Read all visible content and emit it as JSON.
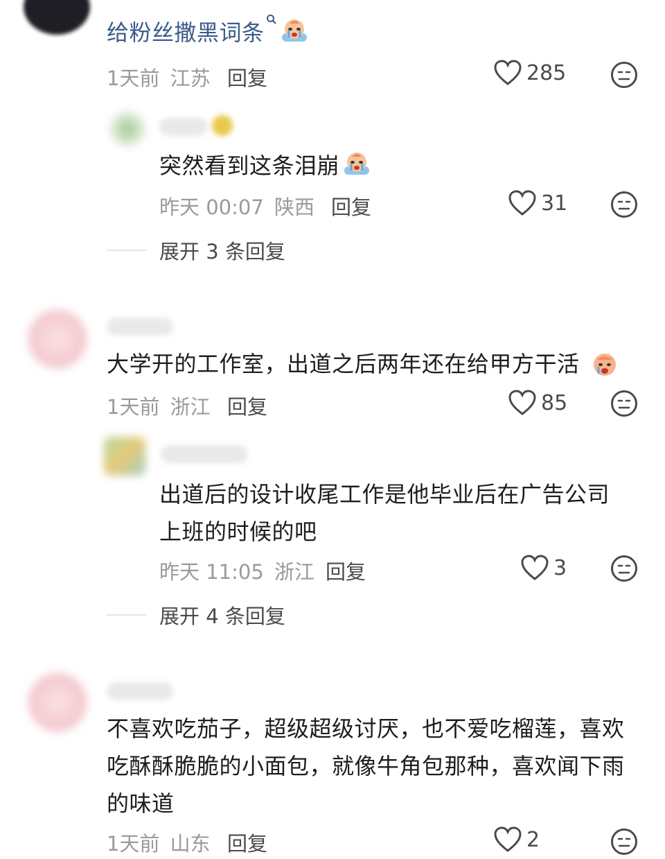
{
  "comments": [
    {
      "text": "给粉丝撒黑词条",
      "date": "1天前",
      "location": "江苏",
      "reply_label": "回复",
      "likes": "285",
      "replies": [
        {
          "text": "突然看到这条泪崩",
          "date": "昨天 00:07",
          "location": "陕西",
          "reply_label": "回复",
          "likes": "31"
        }
      ],
      "expand_label": "展开 3 条回复"
    },
    {
      "text": "大学开的工作室，出道之后两年还在给甲方干活",
      "date": "1天前",
      "location": "浙江",
      "reply_label": "回复",
      "likes": "85",
      "replies": [
        {
          "text_line1": "出道后的设计收尾工作是他毕业后在广告公司",
          "text_line2": "上班的时候的吧",
          "date": "昨天 11:05",
          "location": "浙江",
          "reply_label": "回复",
          "likes": "3"
        }
      ],
      "expand_label": "展开 4 条回复"
    },
    {
      "text_line1": "不喜欢吃茄子，超级超级讨厌，也不爱吃榴莲，喜欢",
      "text_line2": "吃酥酥脆脆的小面包，就像牛角包那种，喜欢闻下雨",
      "text_line3": "的味道",
      "date": "1天前",
      "location": "山东",
      "reply_label": "回复",
      "likes": "2"
    }
  ],
  "icons": {
    "like": "heart-outline-icon",
    "dislike": "neutral-face-icon",
    "search": "search-icon",
    "emoji_cry": "crying-emoji-icon"
  },
  "colors": {
    "link": "#3b5b8a",
    "meta": "#9a9a9a",
    "text": "#1d1d1d"
  }
}
